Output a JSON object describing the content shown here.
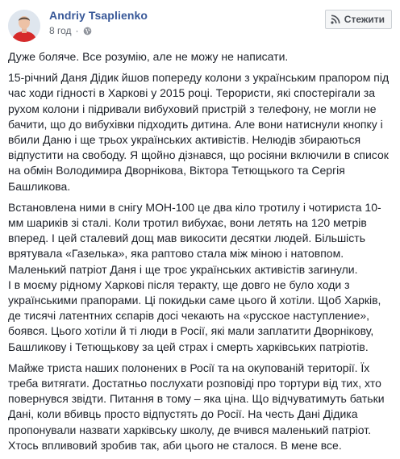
{
  "post": {
    "author": "Andriy Tsaplienko",
    "time": "8 год",
    "privacy_icon": "globe-icon",
    "follow_label": "Стежити",
    "follow_icon": "rss-icon",
    "paragraphs": [
      "Дуже боляче. Все розумію, але не можу не написати.",
      "15-річний Даня Дідик йшов попереду колони з українським прапором під час ходи гідності в Харкові у 2015 році. Терористи, які спостерігали за рухом колони і підривали вибуховий пристрій з телефону, не могли не бачити, що до вибухівки підходить дитина. Але вони натиснули кнопку і вбили Даню і ще трьох українських активістів. Нелюдів збираються відпустити на свободу. Я щойно дізнався, що росіяни включили в список на обмін Володимира Дворнікова, Віктора Тетющького та Сергія Башликова.",
      "Встановлена ними в снігу МОН-100 це два кіло тротилу і чотириста 10-мм шариків зі сталі. Коли тротил вибухає, вони летять на 120 метрів вперед. І цей сталевий дощ мав викосити десятки людей. Більшість врятувала «Газелька», яка раптово стала між міною і натовпом. Маленький патріот Даня і ще троє українських активістів загинули.",
      "І в моєму рідному Харкові після теракту, ще довго не було ходи з українськими прапорами. Ці покидьки саме цього й хотіли. Щоб Харків, де тисячі латентних сєпарів досі чекають на «русское наступление», боявся. Цього хотіли й ті люди в Росії, які мали заплатити Дворнікову, Башликову і Тетющькову за цей страх і смерть харківських патріотів.",
      "Майже триста наших полонених в Росії та на окупованій території. Їх треба витягати. Достатньо послухати розповіді про тортури від тих, хто повернувся звідти. Питання в тому – яка ціна. Що відчуватимуть батьки Дані, коли вбивць просто відпустять до Росії. На честь Дані Дідика пропонували назвати харківську школу, де вчився маленький патріот. Хтось впливовий зробив так, аби цього не сталося. В мене все."
    ]
  }
}
